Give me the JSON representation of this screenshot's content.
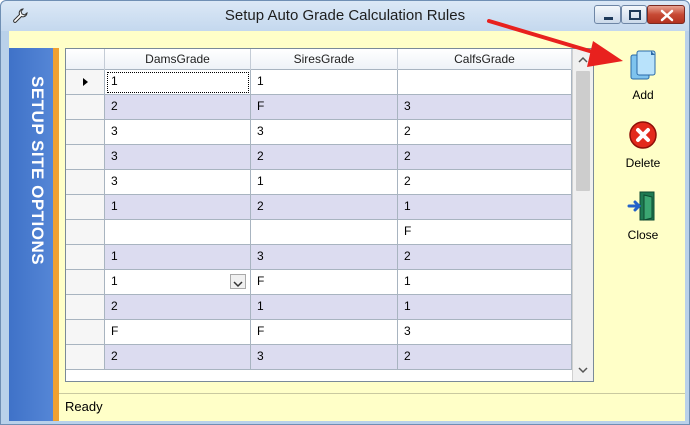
{
  "window": {
    "title": "Setup Auto Grade Calculation Rules"
  },
  "banner": {
    "text": "Setup Site Options"
  },
  "grid": {
    "columns": [
      "DamsGrade",
      "SiresGrade",
      "CalfsGrade"
    ],
    "rows": [
      [
        "1",
        "1",
        ""
      ],
      [
        "2",
        "F",
        "3"
      ],
      [
        "3",
        "3",
        "2"
      ],
      [
        "3",
        "2",
        "2"
      ],
      [
        "3",
        "1",
        "2"
      ],
      [
        "1",
        "2",
        "1"
      ],
      [
        "",
        "",
        "F"
      ],
      [
        "1",
        "3",
        "2"
      ],
      [
        "1",
        "F",
        "1"
      ],
      [
        "2",
        "1",
        "1"
      ],
      [
        "F",
        "F",
        "3"
      ],
      [
        "2",
        "3",
        "2"
      ]
    ]
  },
  "actions": {
    "add_label": "Add",
    "delete_label": "Delete",
    "close_label": "Close"
  },
  "status": {
    "text": "Ready"
  },
  "icons": {
    "title": "wrench-icon",
    "add": "add-document-icon",
    "delete": "red-x-icon",
    "close": "exit-door-icon"
  },
  "colors": {
    "banner": "#4a7fd0",
    "banner_edge": "#f0a030",
    "client_background": "#ffffc8",
    "alt_row": "#dcdcf0",
    "annotation_arrow": "#e8211e"
  }
}
